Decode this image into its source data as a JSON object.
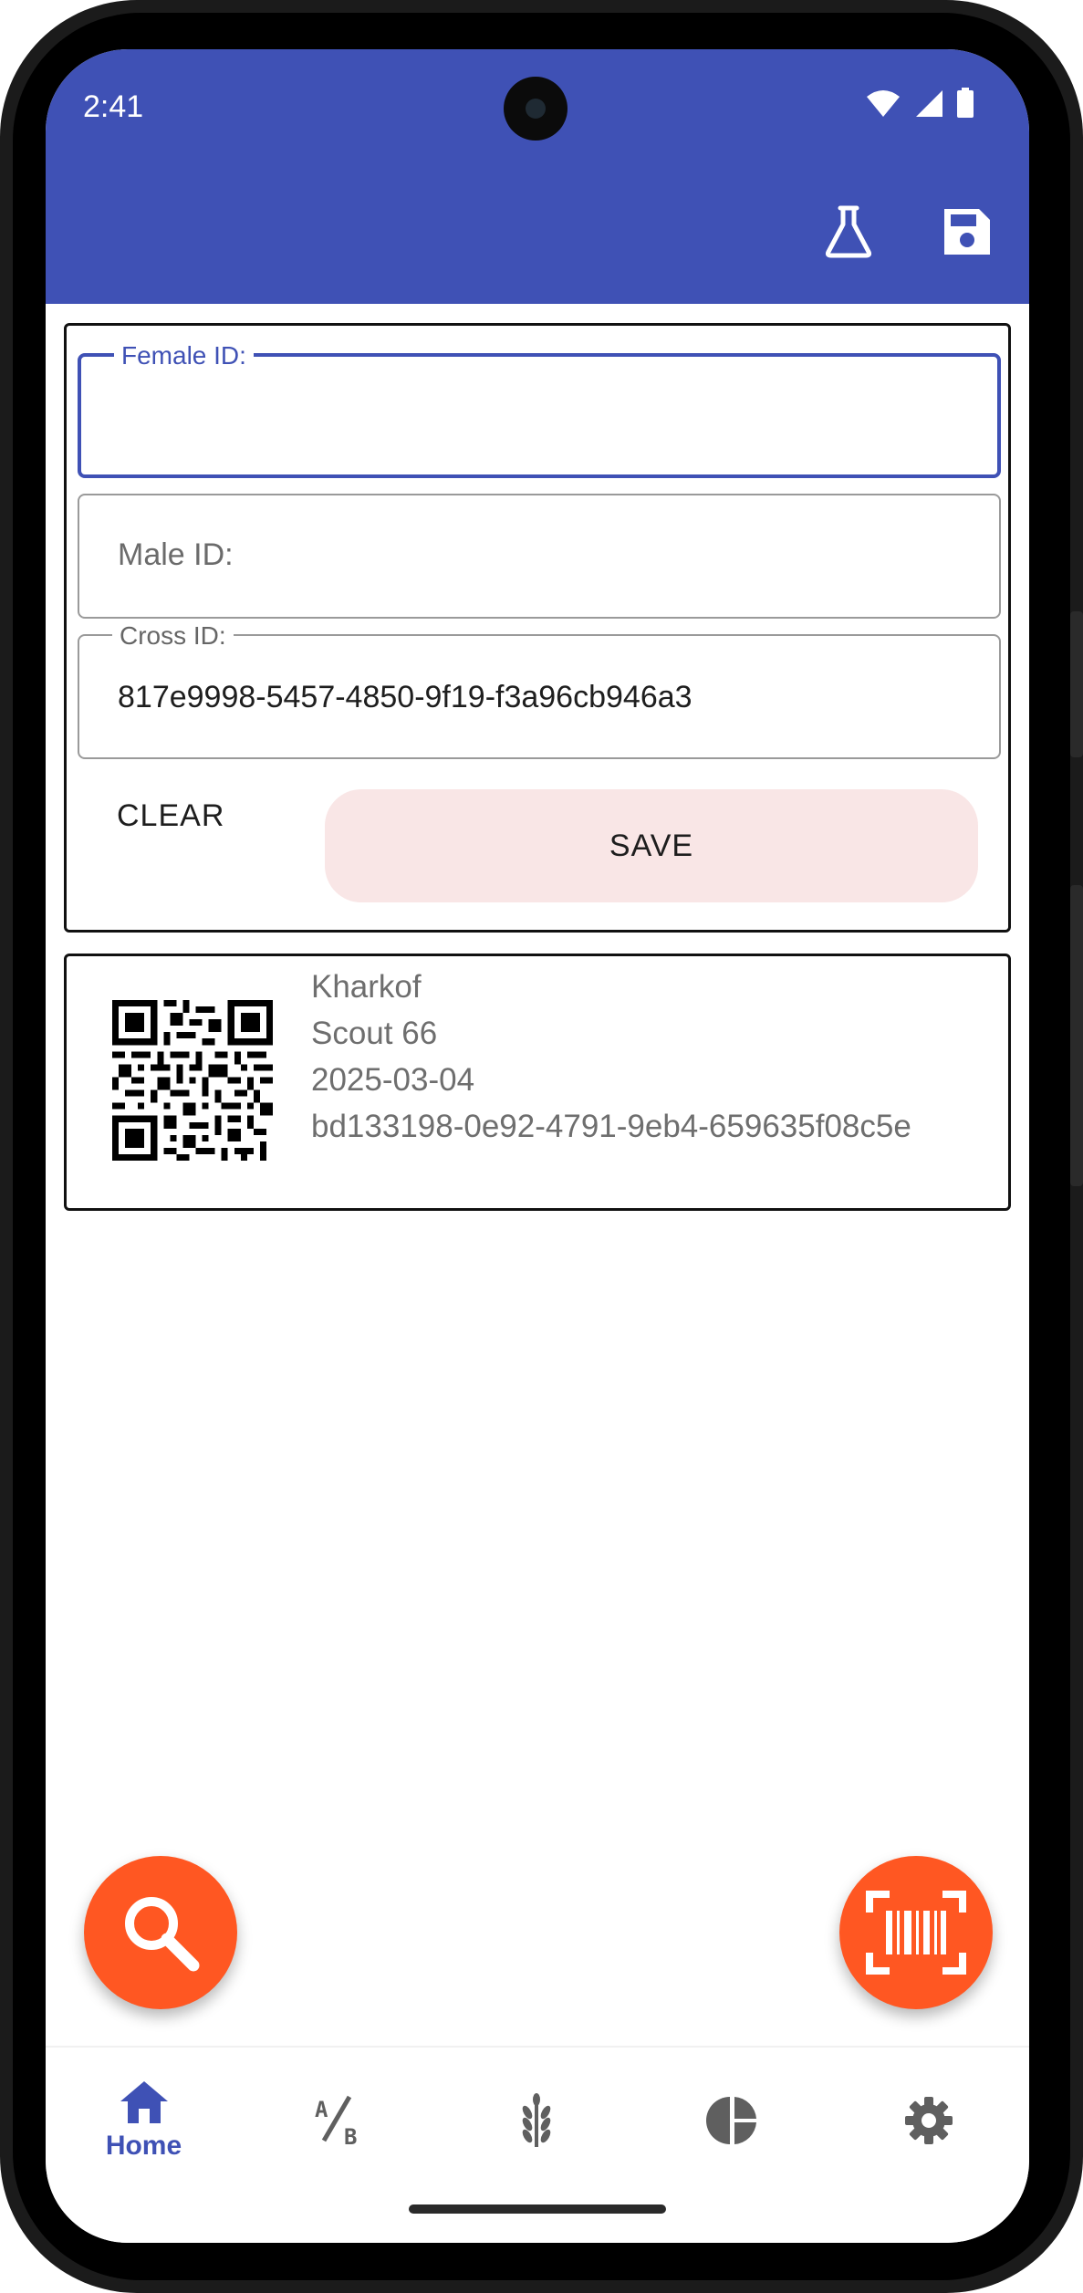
{
  "status_bar": {
    "time": "2:41"
  },
  "appbar": {
    "actions": [
      {
        "name": "flask-icon"
      },
      {
        "name": "save-icon"
      }
    ]
  },
  "form": {
    "female_label": "Female ID:",
    "female_value": "",
    "male_placeholder": "Male ID:",
    "cross_label": "Cross ID:",
    "cross_value": "817e9998-5457-4850-9f19-f3a96cb946a3",
    "clear_label": "CLEAR",
    "save_label": "SAVE"
  },
  "entries": [
    {
      "line1": "Kharkof",
      "line2": "Scout 66",
      "date": "2025-03-04",
      "id": "bd133198-0e92-4791-9eb4-659635f08c5e",
      "icon": "qr-code-icon"
    }
  ],
  "fabs": {
    "search_icon": "search-icon",
    "scan_icon": "barcode-scan-icon"
  },
  "nav": {
    "items": [
      {
        "label": "Home",
        "icon": "home-icon",
        "active": true
      },
      {
        "label": "",
        "icon": "ab-icon"
      },
      {
        "label": "",
        "icon": "wheat-icon"
      },
      {
        "label": "",
        "icon": "pie-chart-icon"
      },
      {
        "label": "",
        "icon": "settings-icon"
      }
    ]
  },
  "colors": {
    "primary": "#3f51b5",
    "fab": "#ff5722",
    "save_button_bg": "#f9e6e6"
  }
}
